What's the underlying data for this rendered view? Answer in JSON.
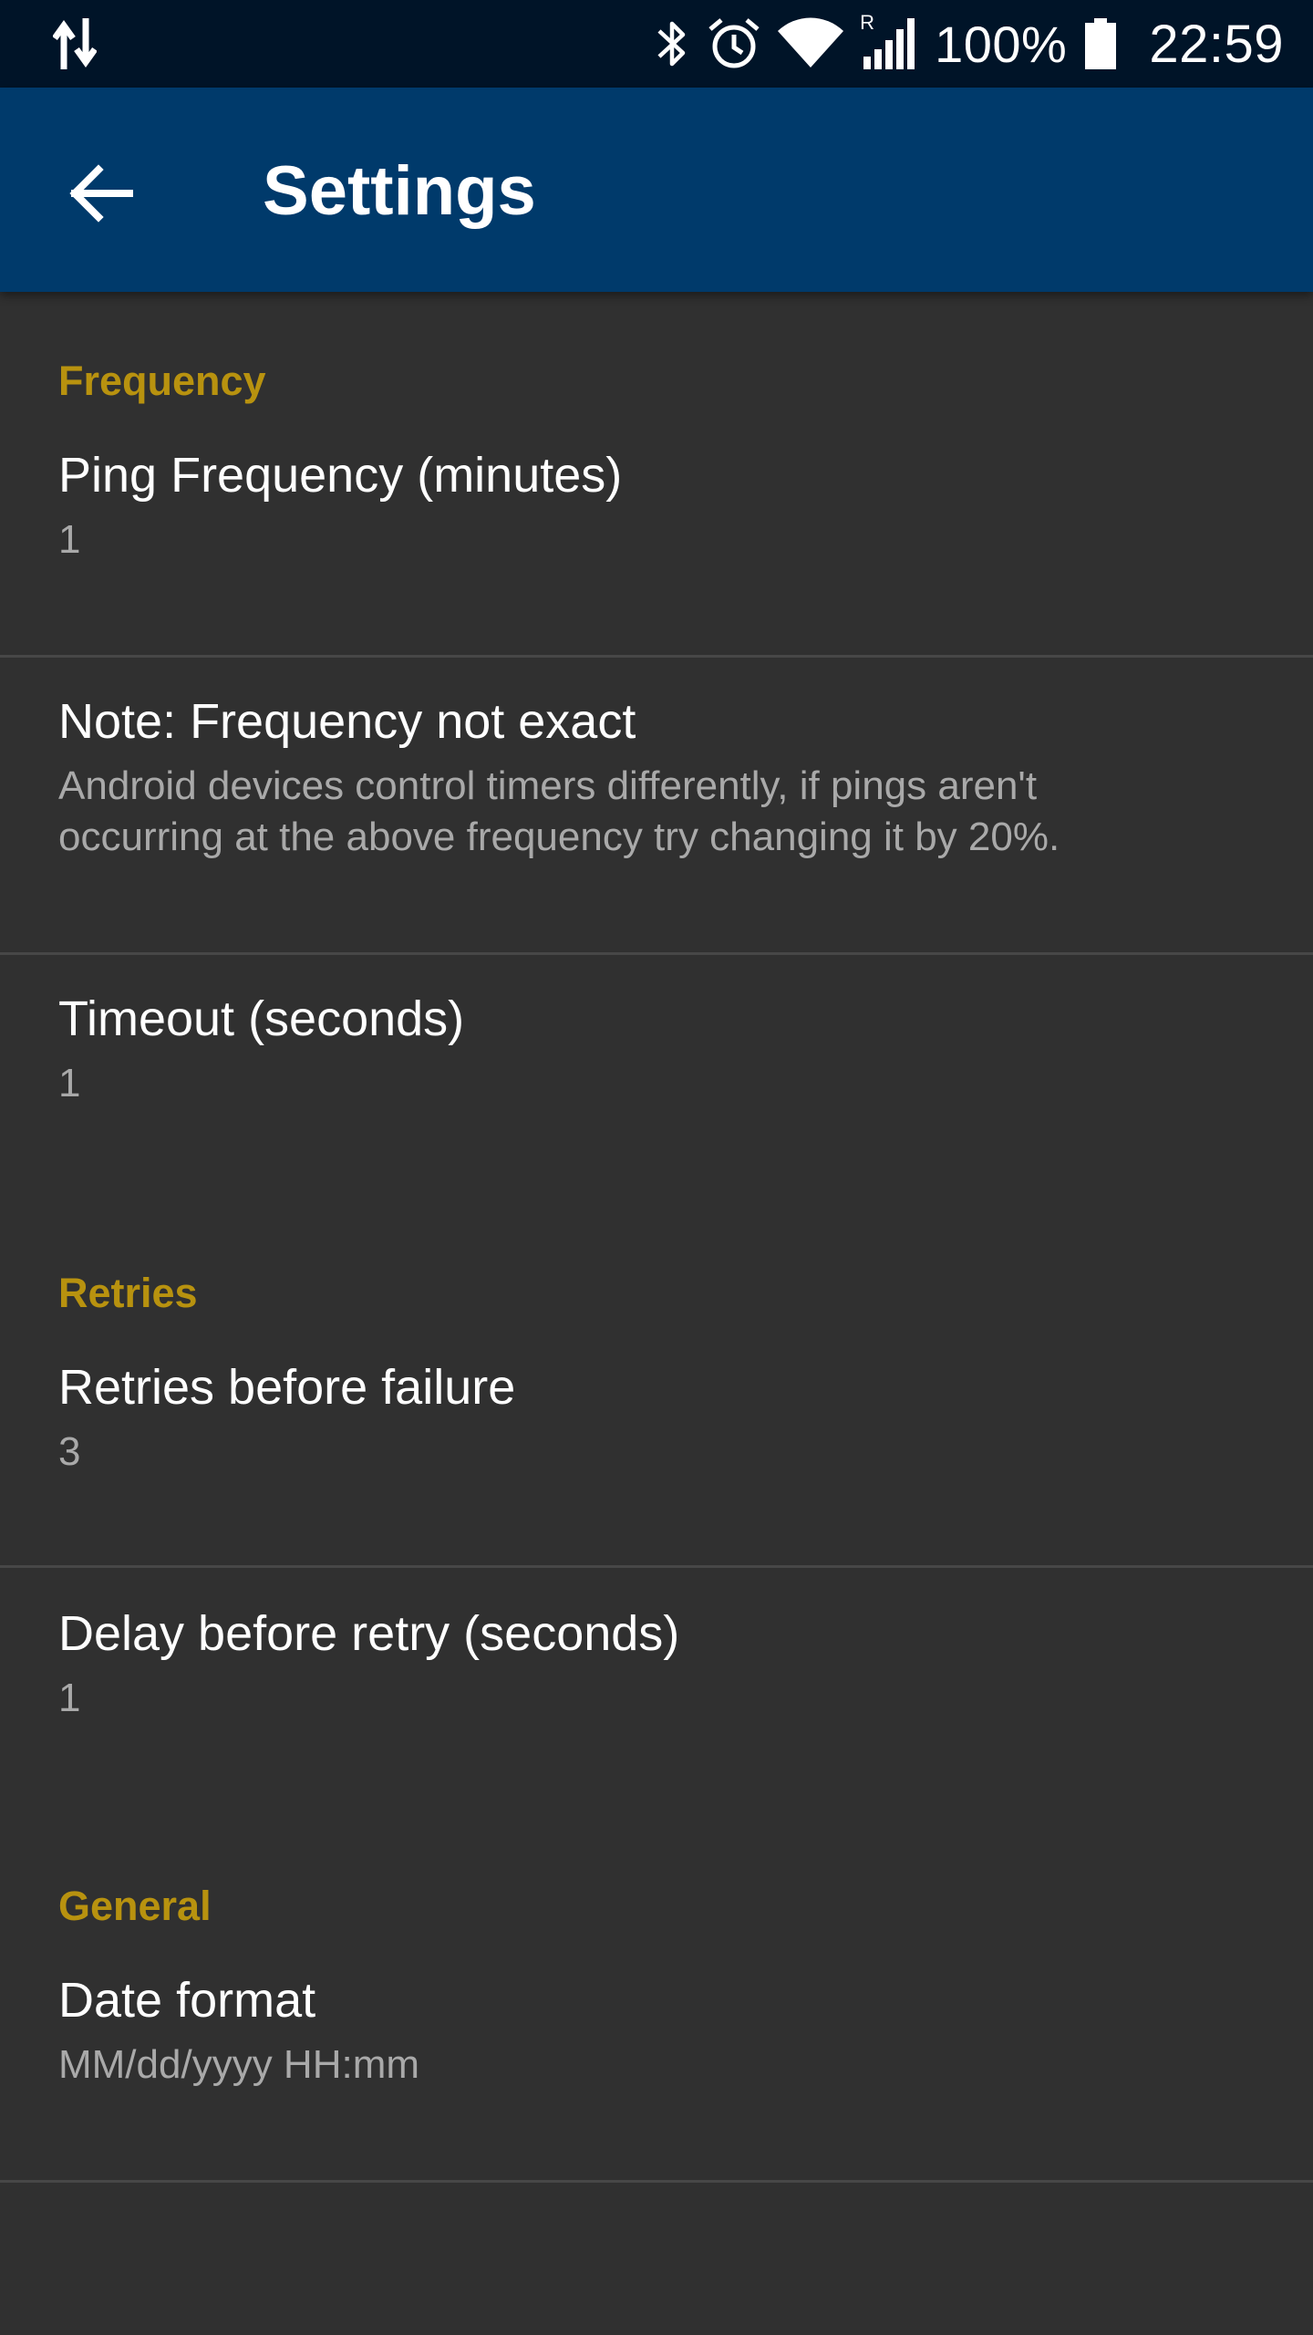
{
  "status_bar": {
    "icons": [
      "data-transfer-icon",
      "bluetooth-icon",
      "alarm-icon",
      "wifi-icon",
      "signal-roaming-icon",
      "battery-icon"
    ],
    "battery": "100%",
    "time": "22:59",
    "roaming": "R"
  },
  "app_bar": {
    "title": "Settings",
    "back_icon": "arrow-back-icon",
    "color": "#003a6b"
  },
  "categories": {
    "frequency": "Frequency",
    "retries": "Retries",
    "general": "General"
  },
  "accent_color": "#b8920f",
  "preferences": {
    "ping_frequency": {
      "title": "Ping Frequency (minutes)",
      "summary": "1"
    },
    "note": {
      "title": "Note: Frequency not exact",
      "summary_line1": "Android devices control timers differently, if pings aren't",
      "summary_line2": "occurring at the above frequency try changing it by 20%."
    },
    "timeout": {
      "title": "Timeout (seconds)",
      "summary": "1"
    },
    "retries_before_failure": {
      "title": "Retries before failure",
      "summary": "3"
    },
    "delay_before_retry": {
      "title": "Delay before retry (seconds)",
      "summary": "1"
    },
    "date_format": {
      "title": "Date format",
      "summary": "MM/dd/yyyy HH:mm"
    }
  }
}
